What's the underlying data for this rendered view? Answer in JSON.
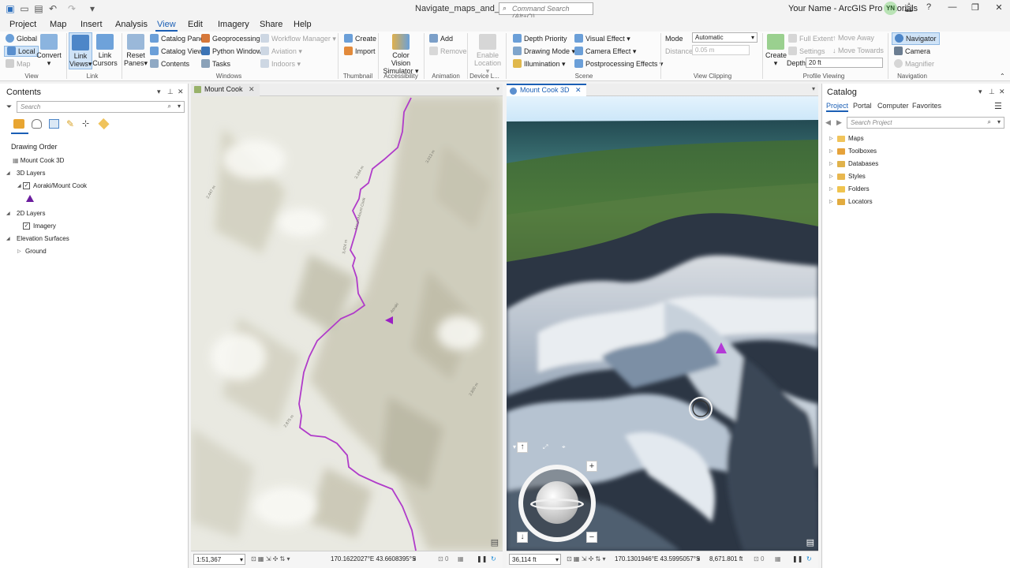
{
  "titlebar": {
    "doc_title": "Navigate_maps_and_scenes",
    "command_search_placeholder": "Command Search (Alt+Q)",
    "user_name": "Your Name - ArcGIS Pro Tutorials",
    "avatar_initials": "YN"
  },
  "menu": [
    "Project",
    "Map",
    "Insert",
    "Analysis",
    "View",
    "Edit",
    "Imagery",
    "Share",
    "Help"
  ],
  "ribbon": {
    "view_group": {
      "global": "Global",
      "local": "Local",
      "map": "Map",
      "convert": "Convert",
      "label": "View"
    },
    "link_group": {
      "link_views": "Link Views",
      "link_cursors": "Link Cursors",
      "label": "Link"
    },
    "windows_group": {
      "reset_panes": "Reset Panes",
      "catalog_pane": "Catalog Pane",
      "catalog_view": "Catalog View",
      "contents": "Contents",
      "geoprocessing": "Geoprocessing",
      "python_window": "Python Window",
      "tasks": "Tasks",
      "workflow_manager": "Workflow Manager",
      "aviation": "Aviation",
      "indoors": "Indoors",
      "label": "Windows"
    },
    "thumbnail_group": {
      "create": "Create",
      "import": "Import",
      "label": "Thumbnail"
    },
    "accessibility_group": {
      "color_vision": "Color Vision Simulator",
      "label": "Accessibility"
    },
    "animation_group": {
      "add": "Add",
      "remove": "Remove",
      "label": "Animation"
    },
    "device_group": {
      "enable_location": "Enable Location",
      "label": "Device L..."
    },
    "scene_group": {
      "depth_priority": "Depth Priority",
      "drawing_mode": "Drawing Mode",
      "illumination": "Illumination",
      "visual_effect": "Visual Effect",
      "camera_effect": "Camera Effect",
      "postprocessing": "Postprocessing Effects",
      "label": "Scene"
    },
    "clipping_group": {
      "mode_label": "Mode",
      "mode_value": "Automatic",
      "distance_label": "Distance",
      "distance_value": "0.05 m",
      "label": "View Clipping"
    },
    "profile_group": {
      "create": "Create",
      "full_extent": "Full Extent",
      "settings": "Settings",
      "move_away": "Move Away",
      "move_towards": "Move Towards",
      "depth_label": "Depth",
      "depth_value": "20 ft",
      "label": "Profile Viewing"
    },
    "navigation_group": {
      "navigator": "Navigator",
      "camera": "Camera",
      "magnifier": "Magnifier",
      "label": "Navigation"
    }
  },
  "contents": {
    "title": "Contents",
    "search_placeholder": "Search",
    "drawing_order": "Drawing Order",
    "scene_name": "Mount Cook 3D",
    "layers_3d": "3D Layers",
    "layer_aoraki": "Aoraki/Mount Cook",
    "layers_2d": "2D Layers",
    "layer_imagery": "Imagery",
    "elevation_surfaces": "Elevation Surfaces",
    "ground": "Ground"
  },
  "view_2d": {
    "tab": "Mount Cook",
    "scale": "1:51,367",
    "coords": "170.1622027°E 43.6608395°S",
    "selected": "0"
  },
  "view_3d": {
    "tab": "Mount Cook 3D",
    "scale": "36,114 ft",
    "coords": "170.1301946°E 43.5995057°S",
    "elevation": "8,671.801 ft",
    "selected": "0"
  },
  "catalog": {
    "title": "Catalog",
    "tabs": [
      "Project",
      "Portal",
      "Computer",
      "Favorites"
    ],
    "search_placeholder": "Search Project",
    "items": [
      "Maps",
      "Toolboxes",
      "Databases",
      "Styles",
      "Folders",
      "Locators"
    ]
  },
  "colors": {
    "accent": "#1b5fb5",
    "route": "#b03bc9",
    "marker": "#9b1fc4"
  }
}
